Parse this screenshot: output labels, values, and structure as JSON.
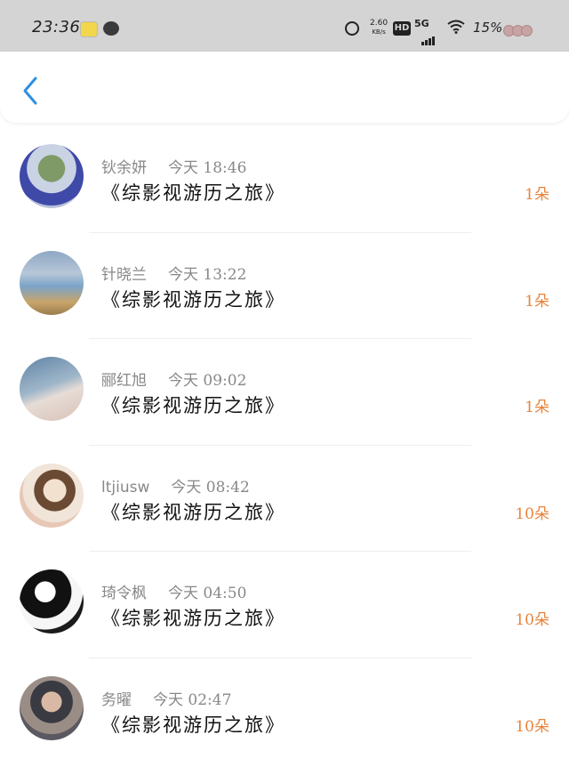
{
  "status_bar": {
    "time": "23:36",
    "net_speed_value": "2.60",
    "net_speed_unit": "KB/s",
    "hd": "HD",
    "network": "5G",
    "battery": "15%",
    "icons": [
      "notification-app-icon",
      "wechat-icon",
      "alarm-icon",
      "signal-icon",
      "wifi-icon"
    ]
  },
  "header": {
    "back_icon": "chevron-left-icon",
    "accent_color": "#2f8fe0"
  },
  "list": {
    "count_color": "#e8833a",
    "items": [
      {
        "name": "钬余妍",
        "time": "今天 18:46",
        "title": "《综影视游历之旅》",
        "count": "1朵"
      },
      {
        "name": "针晓兰",
        "time": "今天 13:22",
        "title": "《综影视游历之旅》",
        "count": "1朵"
      },
      {
        "name": "郦红旭",
        "time": "今天 09:02",
        "title": "《综影视游历之旅》",
        "count": "1朵"
      },
      {
        "name": "ltjiusw",
        "time": "今天 08:42",
        "title": "《综影视游历之旅》",
        "count": "10朵"
      },
      {
        "name": "琦令枫",
        "time": "今天 04:50",
        "title": "《综影视游历之旅》",
        "count": "10朵"
      },
      {
        "name": "务曜",
        "time": "今天 02:47",
        "title": "《综影视游历之旅》",
        "count": "10朵"
      }
    ]
  }
}
